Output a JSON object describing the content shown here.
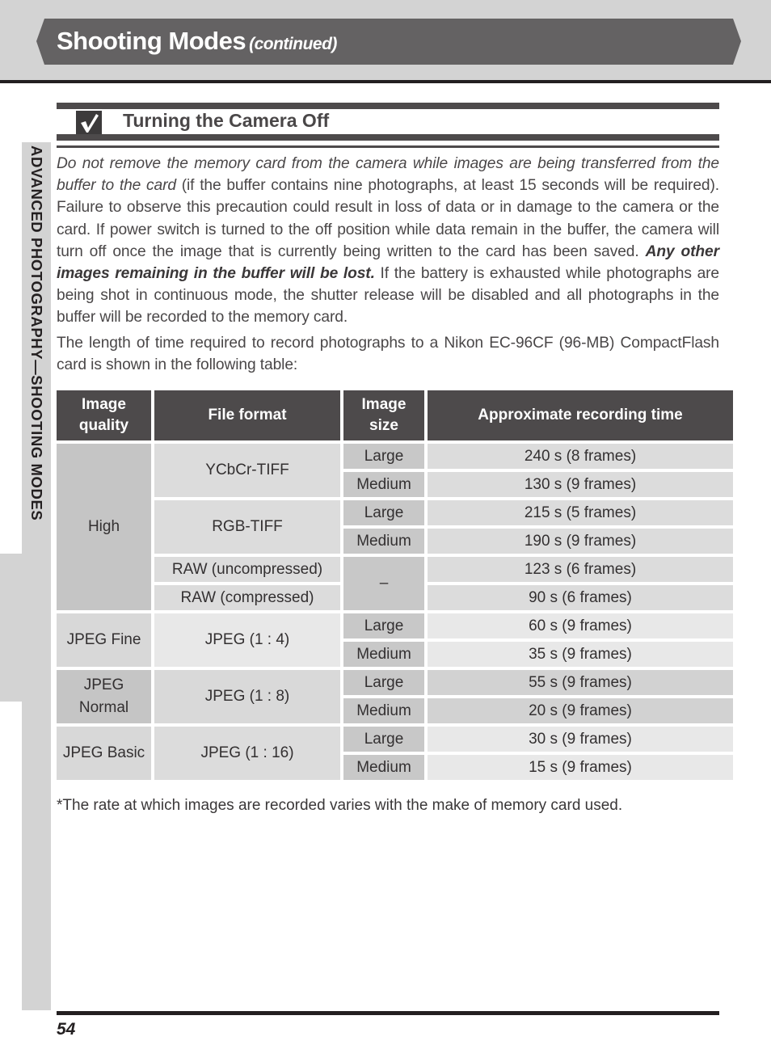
{
  "header": {
    "title": "Shooting Modes",
    "title_suffix": "(continued)"
  },
  "side_tab": {
    "label": "ADVANCED PHOTOGRAPHY—SHOOTING MODES"
  },
  "section": {
    "icon": "checkmark-icon",
    "title": "Turning the Camera Off"
  },
  "body": {
    "para1_italic": "Do not remove the memory card from the camera while images are being transferred from the buffer to the card",
    "para1_normal_a": " (if the buffer contains nine photographs, at least 15 seconds will be required). Failure to observe this precaution could result in loss of data or in damage to the camera or the card.  If power switch is turned to the off position while data remain in the buffer, the camera will turn off once the image that is currently being written to the card has been saved. ",
    "para1_bold": "Any other images remaining in the buffer will be lost.",
    "para1_normal_b": " If the battery is exhausted while photographs are being shot in continuous mode, the shutter release will be disabled and all photographs in the buffer will be recorded to the memory card.",
    "para2": "The length of time required to record photographs to a Nikon EC-96CF (96-MB) CompactFlash card is shown in the following table:"
  },
  "table": {
    "headers": [
      "Image quality",
      "File format",
      "Image size",
      "Approximate recording time"
    ],
    "groups": [
      {
        "quality": "High",
        "formats": [
          {
            "format": "YCbCr-TIFF",
            "rows": [
              {
                "size": "Large",
                "time": "240 s (8 frames)"
              },
              {
                "size": "Medium",
                "time": "130 s (9 frames)"
              }
            ]
          },
          {
            "format": "RGB-TIFF",
            "rows": [
              {
                "size": "Large",
                "time": "215 s (5 frames)"
              },
              {
                "size": "Medium",
                "time": "190 s (9 frames)"
              }
            ]
          },
          {
            "format": "RAW (uncompressed)",
            "size": "–",
            "time": "123 s (6 frames)"
          },
          {
            "format": "RAW (compressed)",
            "time": "90 s (6 frames)"
          }
        ]
      },
      {
        "quality": "JPEG Fine",
        "format": "JPEG (1 : 4)",
        "rows": [
          {
            "size": "Large",
            "time": "60 s (9 frames)"
          },
          {
            "size": "Medium",
            "time": "35 s (9 frames)"
          }
        ]
      },
      {
        "quality": "JPEG Normal",
        "format": "JPEG (1 : 8)",
        "rows": [
          {
            "size": "Large",
            "time": "55 s (9 frames)"
          },
          {
            "size": "Medium",
            "time": "20 s (9 frames)"
          }
        ]
      },
      {
        "quality": "JPEG Basic",
        "format": "JPEG (1 : 16)",
        "rows": [
          {
            "size": "Large",
            "time": "30 s (9 frames)"
          },
          {
            "size": "Medium",
            "time": "15 s (9 frames)"
          }
        ]
      }
    ]
  },
  "footnote": "*The rate at which images are recorded varies with the make of memory card used.",
  "footer": {
    "page_number": "54"
  }
}
